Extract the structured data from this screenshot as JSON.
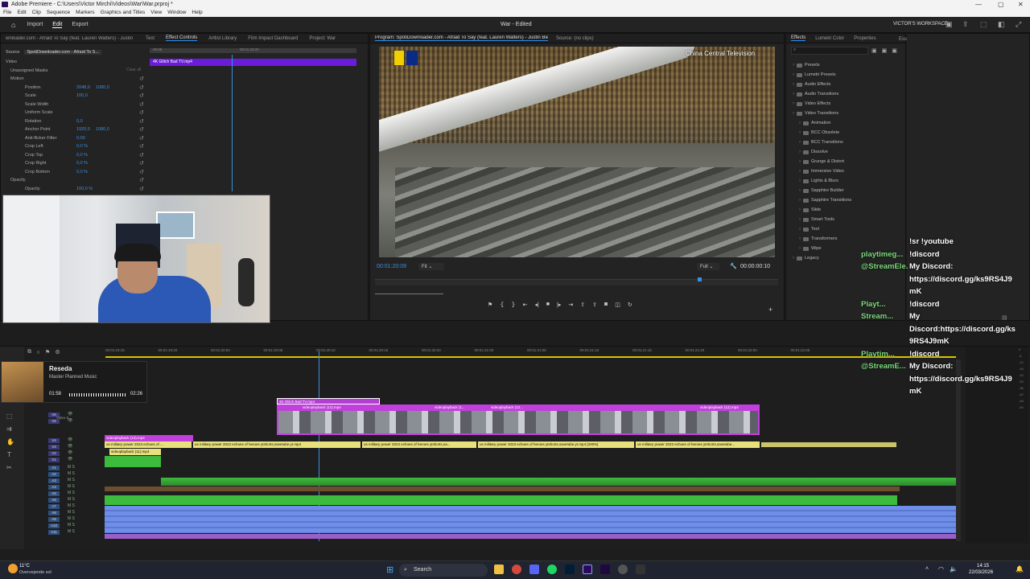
{
  "window": {
    "title": "Adobe Premiere - C:\\Users\\Victor Mirchi\\Videos\\War\\War.prproj *"
  },
  "menu": [
    "File",
    "Edit",
    "Clip",
    "Sequence",
    "Markers",
    "Graphics and Titles",
    "View",
    "Window",
    "Help"
  ],
  "workspace": {
    "tabs": [
      "Import",
      "Edit",
      "Export"
    ],
    "active_tab": "Edit",
    "project_title": "War - Edited",
    "workspace_name": "VICTOR'S WORKSPACE"
  },
  "left_panel": {
    "tabs": [
      "wnloader.com - Afraid To Say (feat. Lauren Walters) - Justin Bieber",
      "Text",
      "Effect Controls",
      "Artlist Library",
      "Film Impact Dashboard",
      "Project: War"
    ],
    "active_tab": "Effect Controls",
    "source_label": "Source",
    "seq_label": "SpotiDownloader.com - Afraid To S...",
    "clip_name": "4K Glitch Bad TV.mp4",
    "time_a": "00:05",
    "time_b": "00:01:20:20",
    "clear_all": "Clear all",
    "rows": [
      {
        "label": "Video",
        "v1": "",
        "v2": ""
      },
      {
        "label": "Unassigned Masks",
        "v1": "",
        "v2": ""
      },
      {
        "label": "Motion",
        "v1": "",
        "v2": ""
      },
      {
        "label": "Position",
        "v1": "2048,0",
        "v2": "1080,0"
      },
      {
        "label": "Scale",
        "v1": "100,0",
        "v2": ""
      },
      {
        "label": "Scale Width",
        "v1": "",
        "v2": ""
      },
      {
        "label": "Uniform Scale",
        "v1": "",
        "v2": ""
      },
      {
        "label": "Rotation",
        "v1": "0,0",
        "v2": ""
      },
      {
        "label": "Anchor Point",
        "v1": "1920,0",
        "v2": "1080,0"
      },
      {
        "label": "Anti-flicker Filter",
        "v1": "0,00",
        "v2": ""
      },
      {
        "label": "Crop Left",
        "v1": "0,0 %",
        "v2": ""
      },
      {
        "label": "Crop Top",
        "v1": "0,0 %",
        "v2": ""
      },
      {
        "label": "Crop Right",
        "v1": "0,0 %",
        "v2": ""
      },
      {
        "label": "Crop Bottom",
        "v1": "0,0 %",
        "v2": ""
      },
      {
        "label": "Opacity",
        "v1": "",
        "v2": ""
      },
      {
        "label": "Opacity",
        "v1": "100,0 %",
        "v2": ""
      }
    ]
  },
  "program_monitor": {
    "title": "Program: SpotiDownloader.com - Afraid To Say (feat. Lauren Walters) - Justin Bieber",
    "source_tab": "Source: (no clips)",
    "watermark": "China Central Television",
    "timecode": "00:01:20:09",
    "fit": "Fit",
    "quality": "Full",
    "duration": "00:00:00:10"
  },
  "effects_panel": {
    "tabs": [
      "Effects",
      "Lumetri Color",
      "Properties",
      "Essential Sound"
    ],
    "active_tab": "Effects",
    "tree": [
      {
        "label": "Presets",
        "level": 0
      },
      {
        "label": "Lumetri Presets",
        "level": 0
      },
      {
        "label": "Audio Effects",
        "level": 0
      },
      {
        "label": "Audio Transitions",
        "level": 0
      },
      {
        "label": "Video Effects",
        "level": 0
      },
      {
        "label": "Video Transitions",
        "level": 0
      },
      {
        "label": "Animation",
        "level": 1
      },
      {
        "label": "BCC Obsolete",
        "level": 1
      },
      {
        "label": "BCC Transitions",
        "level": 1
      },
      {
        "label": "Dissolve",
        "level": 1
      },
      {
        "label": "Grunge & Distort",
        "level": 1
      },
      {
        "label": "Immersive Video",
        "level": 1
      },
      {
        "label": "Lights & Blurs",
        "level": 1
      },
      {
        "label": "Sapphire Builder",
        "level": 1
      },
      {
        "label": "Sapphire Transitions",
        "level": 1
      },
      {
        "label": "Slide",
        "level": 1
      },
      {
        "label": "Smart Tools",
        "level": 1
      },
      {
        "label": "Text",
        "level": 1
      },
      {
        "label": "Transformers",
        "level": 1
      },
      {
        "label": "Wipe",
        "level": 1
      },
      {
        "label": "Legacy",
        "level": 0
      }
    ]
  },
  "chat": [
    {
      "user": "",
      "msg": "!sr !youtube"
    },
    {
      "user": "playtimeg...",
      "msg": "!discord"
    },
    {
      "user": "@StreamEle...",
      "msg": "My Discord:"
    },
    {
      "user": "",
      "msg": "https://discord.gg/ks9RS4J9"
    },
    {
      "user": "",
      "msg": "mK"
    },
    {
      "user": "Playt...",
      "msg": "!discord"
    },
    {
      "user": "Stream...",
      "msg": "My"
    },
    {
      "user": "",
      "msg": "Discord:https://discord.gg/ks"
    },
    {
      "user": "",
      "msg": "9RS4J9mK"
    },
    {
      "user": "Playtim...",
      "msg": "!discord"
    },
    {
      "user": "@StreamE...",
      "msg": "My Discord:"
    },
    {
      "user": "",
      "msg": "https://discord.gg/ks9RS4J9"
    },
    {
      "user": "",
      "msg": "mK"
    }
  ],
  "music_widget": {
    "title": "Reseda",
    "artist": "Master Planned Music",
    "elapsed": "01:58",
    "total": "02:26",
    "progress": 0.81
  },
  "timeline": {
    "ruler": [
      "00:01:19:15",
      "00:01:19:20",
      "00:01:20:00",
      "00:01:20:05",
      "00:01:20:10",
      "00:01:20:15",
      "00:01:20:20",
      "00:01:21:00",
      "00:01:21:05",
      "00:01:21:10",
      "00:01:21:15",
      "00:01:21:20",
      "00:01:22:00",
      "00:01:22:05"
    ],
    "track_labels": [
      "V6",
      "V5",
      "V4",
      "V3",
      "V2",
      "V1",
      "A1",
      "A2",
      "A3",
      "A4",
      "A5",
      "A6",
      "A7",
      "A8",
      "A9",
      "A10",
      "A11"
    ],
    "video5_label": "Video 5",
    "clips": {
      "glitch": "4K Glitch Bad TV.mp4",
      "v4": [
        "videoplayback (12).mp4",
        "videoplayback (1...",
        "videoplayback (12...",
        "videoplayback (12).mp4"
      ],
      "v4_small": [
        "videoplayback (13).mp4"
      ],
      "v3": [
        "us military power 2023 echoes of ...",
        "us military power 2023 echoes of heroes ytshorts,savetube.yt.mp4",
        "us military power 2023 echoes of heroes ytshorts,sa...",
        "us military power 2023 echoes of heroes ytshorts,savetube.yt.mp4 [200%]",
        "us military power 2023 echoes of heroes ytshorts,savetube..."
      ],
      "v2": [
        "videoplayback (11).mp4"
      ],
      "transitions": [
        "Luma",
        "Luma Fade",
        "Cross D...",
        "Luma Fade",
        "Luma",
        "Cross Dissol..."
      ]
    }
  },
  "taskbar": {
    "weather_temp": "11°C",
    "weather_desc": "Overvejende sol",
    "search": "Search",
    "time": "14:15",
    "date": "22/03/2026"
  },
  "colors": {
    "accent": "#2d8ceb",
    "clip_magenta": "#c13fdc",
    "clip_yellow": "#e8e07a",
    "audio_green": "#3dbb3d",
    "audio_blue": "#6e8ee8",
    "playhead": "#3a8fe0"
  }
}
